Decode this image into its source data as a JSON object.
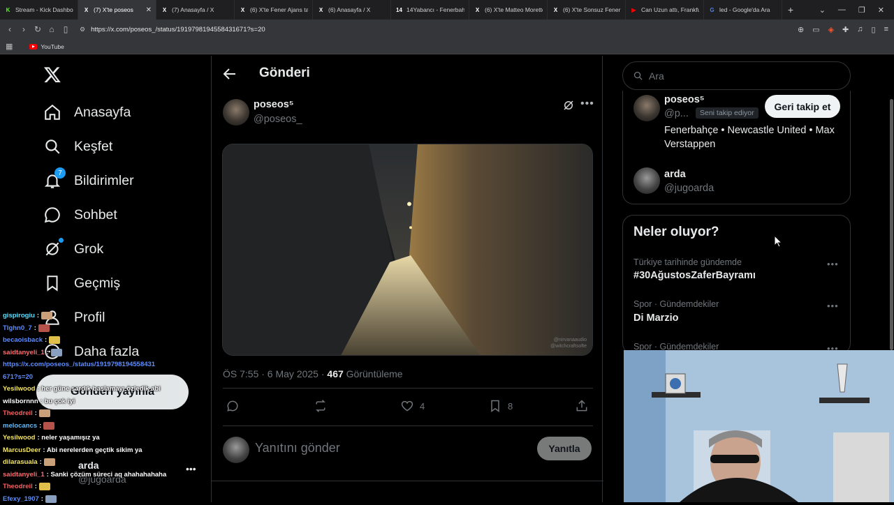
{
  "browser": {
    "tabs": [
      {
        "label": "Stream - Kick Dashbo",
        "fav": "K",
        "fav_color": "#53fc18",
        "active": false
      },
      {
        "label": "(7) X'te poseos",
        "fav": "X",
        "fav_color": "#ffffff",
        "active": true
      },
      {
        "label": "(7) Anasayfa / X",
        "fav": "X",
        "fav_color": "#ffffff",
        "active": false
      },
      {
        "label": "(6) X'te Fener Ajans ta",
        "fav": "X",
        "fav_color": "#ffffff",
        "active": false
      },
      {
        "label": "(6) Anasayfa / X",
        "fav": "X",
        "fav_color": "#ffffff",
        "active": false
      },
      {
        "label": "14Yabancı - Fenerbahç",
        "fav": "14",
        "fav_color": "#ffffff",
        "active": false
      },
      {
        "label": "(6) X'te Matteo Moretto",
        "fav": "X",
        "fav_color": "#ffffff",
        "active": false
      },
      {
        "label": "(6) X'te Sonsuz Fener",
        "fav": "X",
        "fav_color": "#ffffff",
        "active": false
      },
      {
        "label": "Can Uzun attı, Frankfu",
        "fav": "▶",
        "fav_color": "#ff0000",
        "active": false
      },
      {
        "label": "led - Google'da Ara",
        "fav": "G",
        "fav_color": "#4285f4",
        "active": false
      }
    ],
    "url": "https://x.com/poseos_/status/1919798194558431671?s=20",
    "bookmark": "YouTube"
  },
  "nav": {
    "items": [
      {
        "label": "Anasayfa",
        "icon": "home-icon"
      },
      {
        "label": "Keşfet",
        "icon": "search-icon"
      },
      {
        "label": "Bildirimler",
        "icon": "bell-icon",
        "badge": "7"
      },
      {
        "label": "Sohbet",
        "icon": "chat-icon"
      },
      {
        "label": "Grok",
        "icon": "grok-icon"
      },
      {
        "label": "Geçmiş",
        "icon": "bookmark-icon"
      },
      {
        "label": "Profil",
        "icon": "person-icon"
      },
      {
        "label": "Daha fazla",
        "icon": "more-circle-icon"
      }
    ],
    "post_button": "Gönderi yayınla",
    "profile": {
      "name": "arda",
      "handle": "@jugoarda"
    }
  },
  "chat": [
    {
      "user": "gispirogiu",
      "color": "#5ce0ff",
      "msg": ":"
    },
    {
      "user": "Tlghn0_7",
      "color": "#5c8cff",
      "msg": ":"
    },
    {
      "user": "becaoisback",
      "color": "#5c8cff",
      "msg": ":"
    },
    {
      "user": "saidtanyeli_1",
      "color": "#ff6b6b",
      "msg": ":"
    },
    {
      "user": "https://x.com/poseos_/status/1919798194558431",
      "color": "#5c8cff",
      "msg": ""
    },
    {
      "user": "671?s=20",
      "color": "#5c8cff",
      "msg": ""
    },
    {
      "user": "Yesilwood",
      "color": "#f5e663",
      "msg": ": her güne sardık başlamayı özledik abi"
    },
    {
      "user": "wilsbornnn",
      "color": "#ffffff",
      "msg": ": bu çok iyi"
    },
    {
      "user": "Theodreil",
      "color": "#ff5c5c",
      "msg": ":"
    },
    {
      "user": "melocancs",
      "color": "#5cbcff",
      "msg": ":"
    },
    {
      "user": "Yesilwood",
      "color": "#f5e663",
      "msg": ": neler yaşamışız ya"
    },
    {
      "user": "MarcusDeer",
      "color": "#f5e663",
      "msg": ": Abi nerelerden geçtik sikim ya"
    },
    {
      "user": "dilarasuala",
      "color": "#f5e663",
      "msg": ":"
    },
    {
      "user": "saidtanyeli_1",
      "color": "#ff6b6b",
      "msg": ": Sanki çözüm süreci aq ahahahahaha"
    },
    {
      "user": "Theodreil",
      "color": "#ff5c5c",
      "msg": ":"
    },
    {
      "user": "Efexy_1907",
      "color": "#5c8cff",
      "msg": ":"
    }
  ],
  "post": {
    "header_title": "Gönderi",
    "author_name": "poseos⁵",
    "author_handle": "@poseos_",
    "time": "ÖS 7:55 · 6 May 2025 · ",
    "views_count": "467",
    "views_label": " Görüntüleme",
    "like_count": "4",
    "bookmark_count": "8",
    "watermark": "@nirvanaaudio\n@witchcraftsofte",
    "reply_placeholder": "Yanıtını gönder",
    "reply_button": "Yanıtla"
  },
  "sidebar": {
    "search_placeholder": "Ara",
    "relevant": [
      {
        "name": "poseos⁵",
        "handle": "@p...",
        "follows_you": "Seni takip ediyor",
        "button": "Geri takip et",
        "bio": "Fenerbahçe • Newcastle United • Max Verstappen"
      },
      {
        "name": "arda",
        "handle": "@jugoarda"
      }
    ],
    "trends_title": "Neler oluyor?",
    "trends": [
      {
        "meta": "Türkiye tarihinde gündemde",
        "name": "#30AğustosZaferBayramı"
      },
      {
        "meta": "Spor · Gündemdekiler",
        "name": "Di Marzio"
      },
      {
        "meta": "Spor · Gündemdekiler",
        "name": ""
      }
    ]
  },
  "colors": {
    "accent": "#1d9bf0",
    "background": "#000000",
    "text": "#e7e9ea",
    "muted": "#71767b"
  }
}
